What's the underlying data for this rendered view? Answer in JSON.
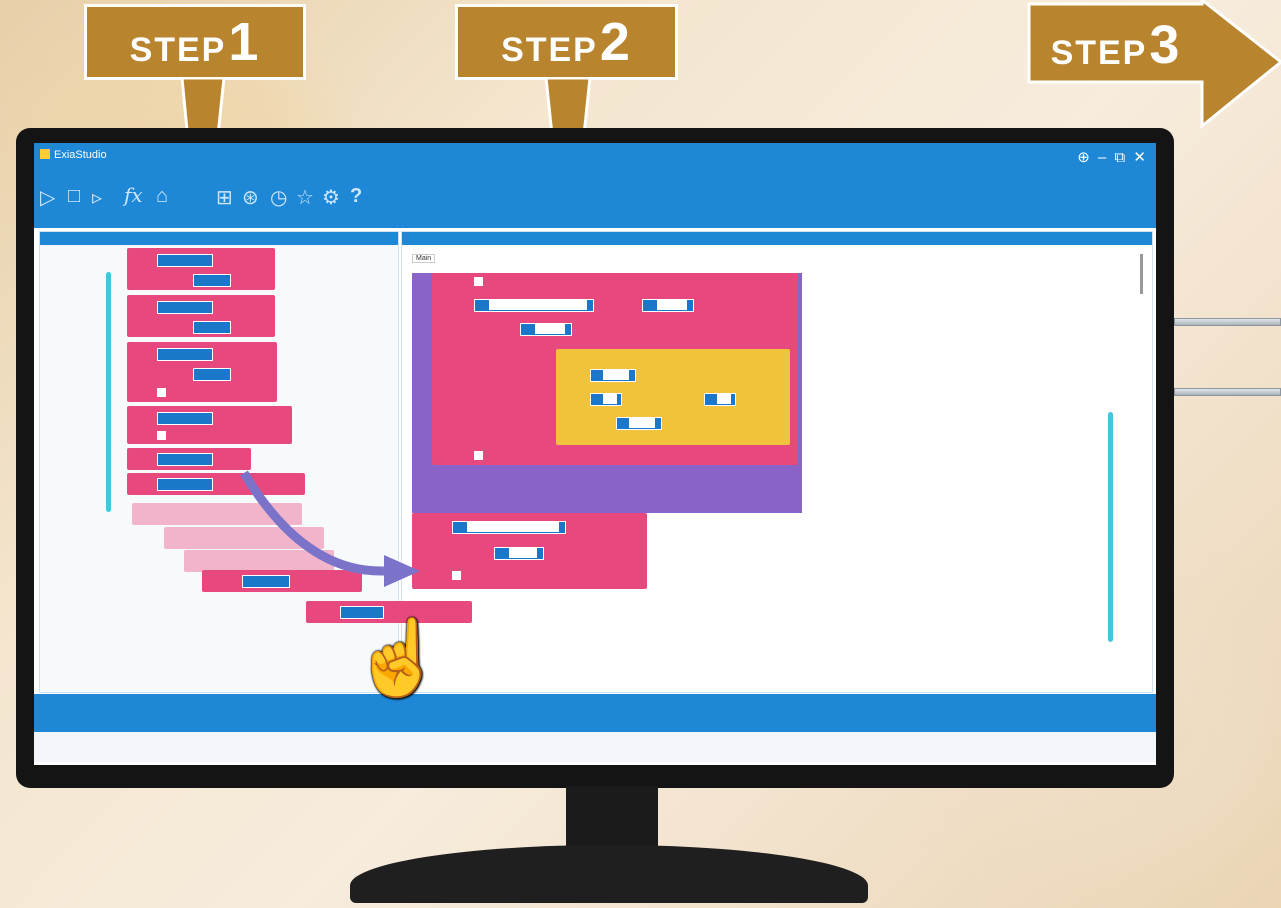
{
  "steps": [
    {
      "word": "STEP",
      "num": "1"
    },
    {
      "word": "STEP",
      "num": "2"
    },
    {
      "word": "STEP",
      "num": "3"
    }
  ],
  "app": {
    "title": "ExiaStudio"
  },
  "toolbar": {
    "icons": [
      "play-icon",
      "stop-icon",
      "step-icon",
      "function-icon",
      "robot-icon",
      "grid-icon",
      "globe-icon",
      "timer-icon",
      "star-icon",
      "gear-icon",
      "help-icon"
    ],
    "help_label": "?"
  },
  "editor": {
    "tab_label": "Main"
  },
  "colors": {
    "accent": "#1e88d6",
    "block_pink": "#e7497f",
    "block_purple": "#8a63c8",
    "block_yellow": "#f1c23b",
    "step_gold": "#b8842e",
    "scrollbar": "#44c6df"
  }
}
